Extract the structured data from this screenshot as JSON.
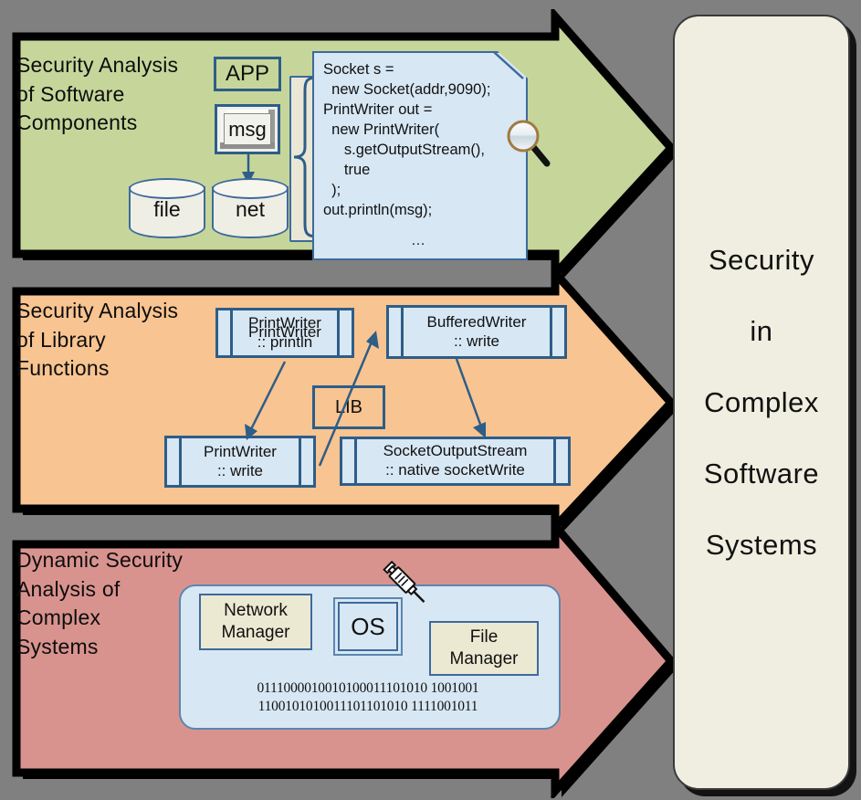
{
  "background_color": "#808080",
  "bands": [
    {
      "id": "components",
      "title": "Security Analysis\nof Software\nComponents",
      "fill": "#c6d69b",
      "stroke": "#000000"
    },
    {
      "id": "library",
      "title": "Security Analysis\nof Library\nFunctions",
      "fill": "#f8c491",
      "stroke": "#000000"
    },
    {
      "id": "dynamic",
      "title": "Dynamic Security\nAnalysis of\nComplex\nSystems",
      "fill": "#d9938f",
      "stroke": "#000000"
    }
  ],
  "pillar": {
    "fill": "#efeee0",
    "words": [
      "Security",
      "in",
      "Complex",
      "Software",
      "Systems"
    ]
  },
  "components": {
    "app_label": "APP",
    "msg_label": "msg",
    "store_file": "file",
    "store_net": "net",
    "code": "Socket s =\n  new Socket(addr,9090);\nPrintWriter out =\n  new PrintWriter(\n     s.getOutputStream(),\n     true\n  );\nout.println(msg);",
    "code_ellipsis": "…",
    "magnifier_icon": "magnifier-icon"
  },
  "library": {
    "lib_label": "LIB",
    "functions": [
      {
        "name": "PrintWriter",
        "method": ":: println"
      },
      {
        "name": "BufferedWriter",
        "method": ":: write"
      },
      {
        "name": "PrintWriter",
        "method": ":: write"
      },
      {
        "name": "SocketOutputStream",
        "method": ":: native socketWrite"
      }
    ]
  },
  "dynamic": {
    "modules": [
      {
        "label": "Network\nManager"
      },
      {
        "label": "File\nManager"
      }
    ],
    "os_label": "OS",
    "syringe_icon": "syringe-icon",
    "binary": "0111000010010100011101010 1001001\n1100101010011101101010 1111001011"
  }
}
